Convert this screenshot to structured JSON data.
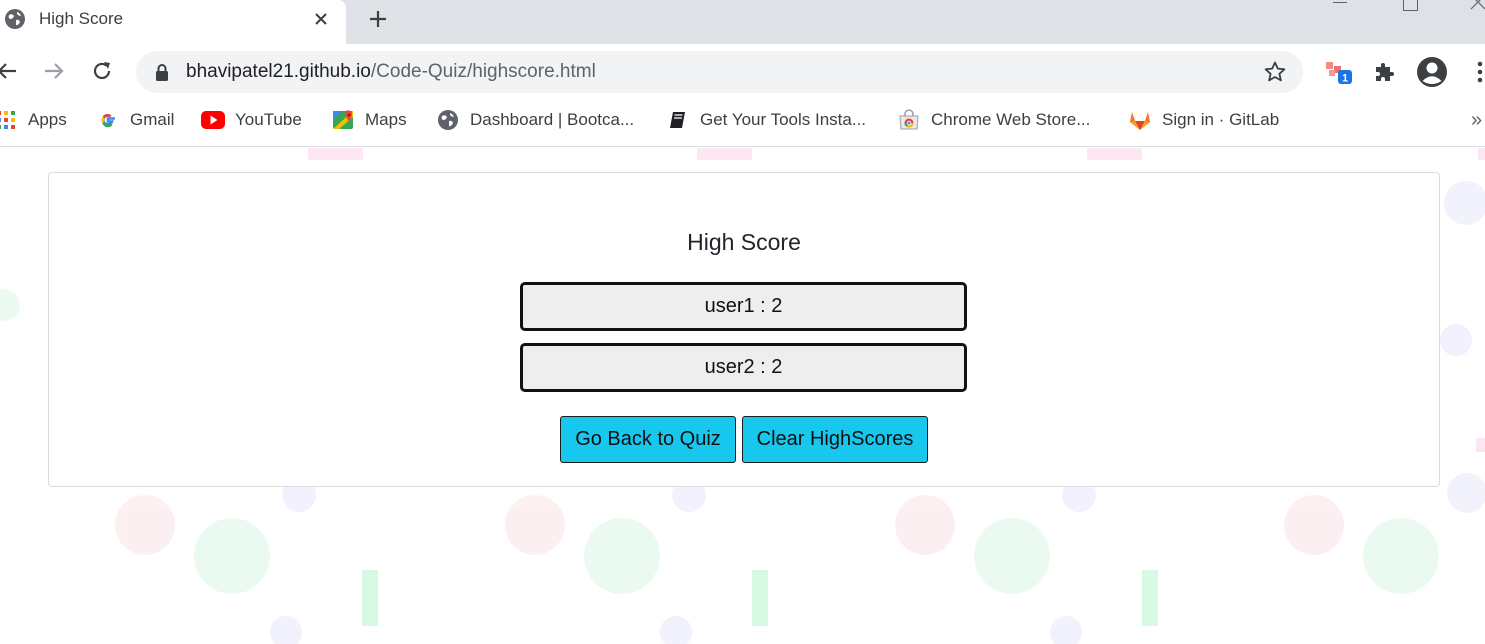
{
  "browser": {
    "tab_title": "High Score",
    "url_host": "bhavipatel21.github.io",
    "url_path": "/Code-Quiz/highscore.html",
    "extension_badge": "1"
  },
  "bookmarks": [
    {
      "label": "Apps",
      "icon": "apps-grid-icon"
    },
    {
      "label": "Gmail",
      "icon": "google-g-icon"
    },
    {
      "label": "YouTube",
      "icon": "youtube-icon"
    },
    {
      "label": "Maps",
      "icon": "maps-pin-icon"
    },
    {
      "label": "Dashboard | Bootca...",
      "icon": "globe-icon"
    },
    {
      "label": "Get Your Tools Insta...",
      "icon": "book-icon"
    },
    {
      "label": "Chrome Web Store...",
      "icon": "web-store-icon"
    },
    {
      "label": "Sign in · GitLab",
      "icon": "gitlab-icon"
    }
  ],
  "bookmarks_overflow": "»",
  "page": {
    "title": "High Score",
    "scores": [
      "user1 : 2",
      "user2 : 2"
    ],
    "buttons": {
      "back": "Go Back to Quiz",
      "clear": "Clear HighScores"
    }
  },
  "colors": {
    "button_bg": "#17c7ee",
    "score_bg": "#eeeeee"
  }
}
